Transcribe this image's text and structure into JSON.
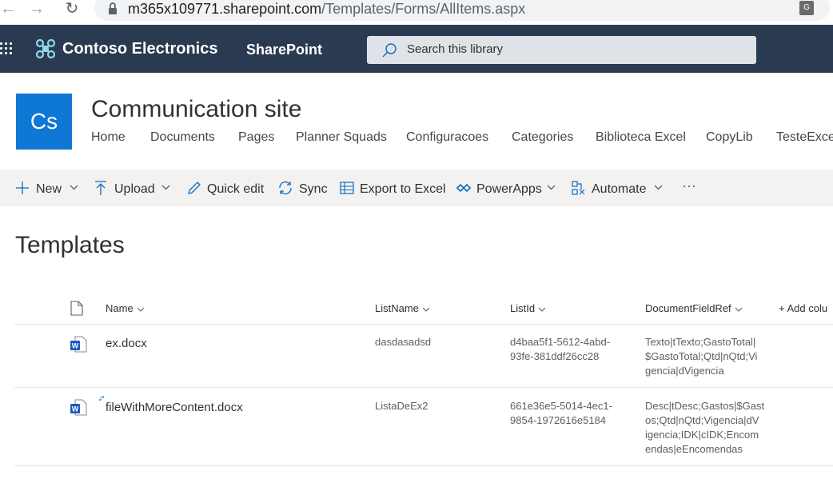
{
  "browser": {
    "url_host": "m365x109771.sharepoint.com",
    "url_path": "/Templates/Forms/AllItems.aspx"
  },
  "suite_bar": {
    "brand": "Contoso Electronics",
    "app": "SharePoint",
    "search_placeholder": "Search this library"
  },
  "site": {
    "logo_text": "Cs",
    "title": "Communication site",
    "nav": [
      "Home",
      "Documents",
      "Pages",
      "Planner Squads",
      "Configuracoes",
      "Categories",
      "Biblioteca Excel",
      "CopyLib",
      "TesteExcel"
    ]
  },
  "commands": {
    "new": "New",
    "upload": "Upload",
    "quick_edit": "Quick edit",
    "sync": "Sync",
    "export": "Export to Excel",
    "powerapps": "PowerApps",
    "automate": "Automate",
    "more": "···"
  },
  "library_title": "Templates",
  "columns": {
    "name": "Name",
    "listname": "ListName",
    "listid": "ListId",
    "docfieldref": "DocumentFieldRef",
    "add_column": "+ Add colu"
  },
  "rows": [
    {
      "name": "ex.docx",
      "listname": "dasdasadsd",
      "listid": [
        "d4baa5f1-5612-4abd-",
        "93fe-381ddf26cc28"
      ],
      "docfieldref": [
        "Texto|tTexto;GastoTotal|",
        "$GastoTotal;Qtd|nQtd;Vi",
        "gencia|dVigencia"
      ]
    },
    {
      "name": "fileWithMoreContent.docx",
      "listname": "ListaDeEx2",
      "listid": [
        "661e36e5-5014-4ec1-",
        "9854-1972616e5184"
      ],
      "docfieldref": [
        "Desc|tDesc;Gastos|$Gast",
        "os;Qtd|nQtd;Vigencia|dV",
        "igencia;IDK|cIDK;Encom",
        "endas|eEncomendas"
      ]
    }
  ],
  "colors": {
    "suite_bar": "#2a3a50",
    "site_logo": "#0f78d4",
    "command_bar": "#f3f2f1",
    "word_blue": "#185abd"
  }
}
